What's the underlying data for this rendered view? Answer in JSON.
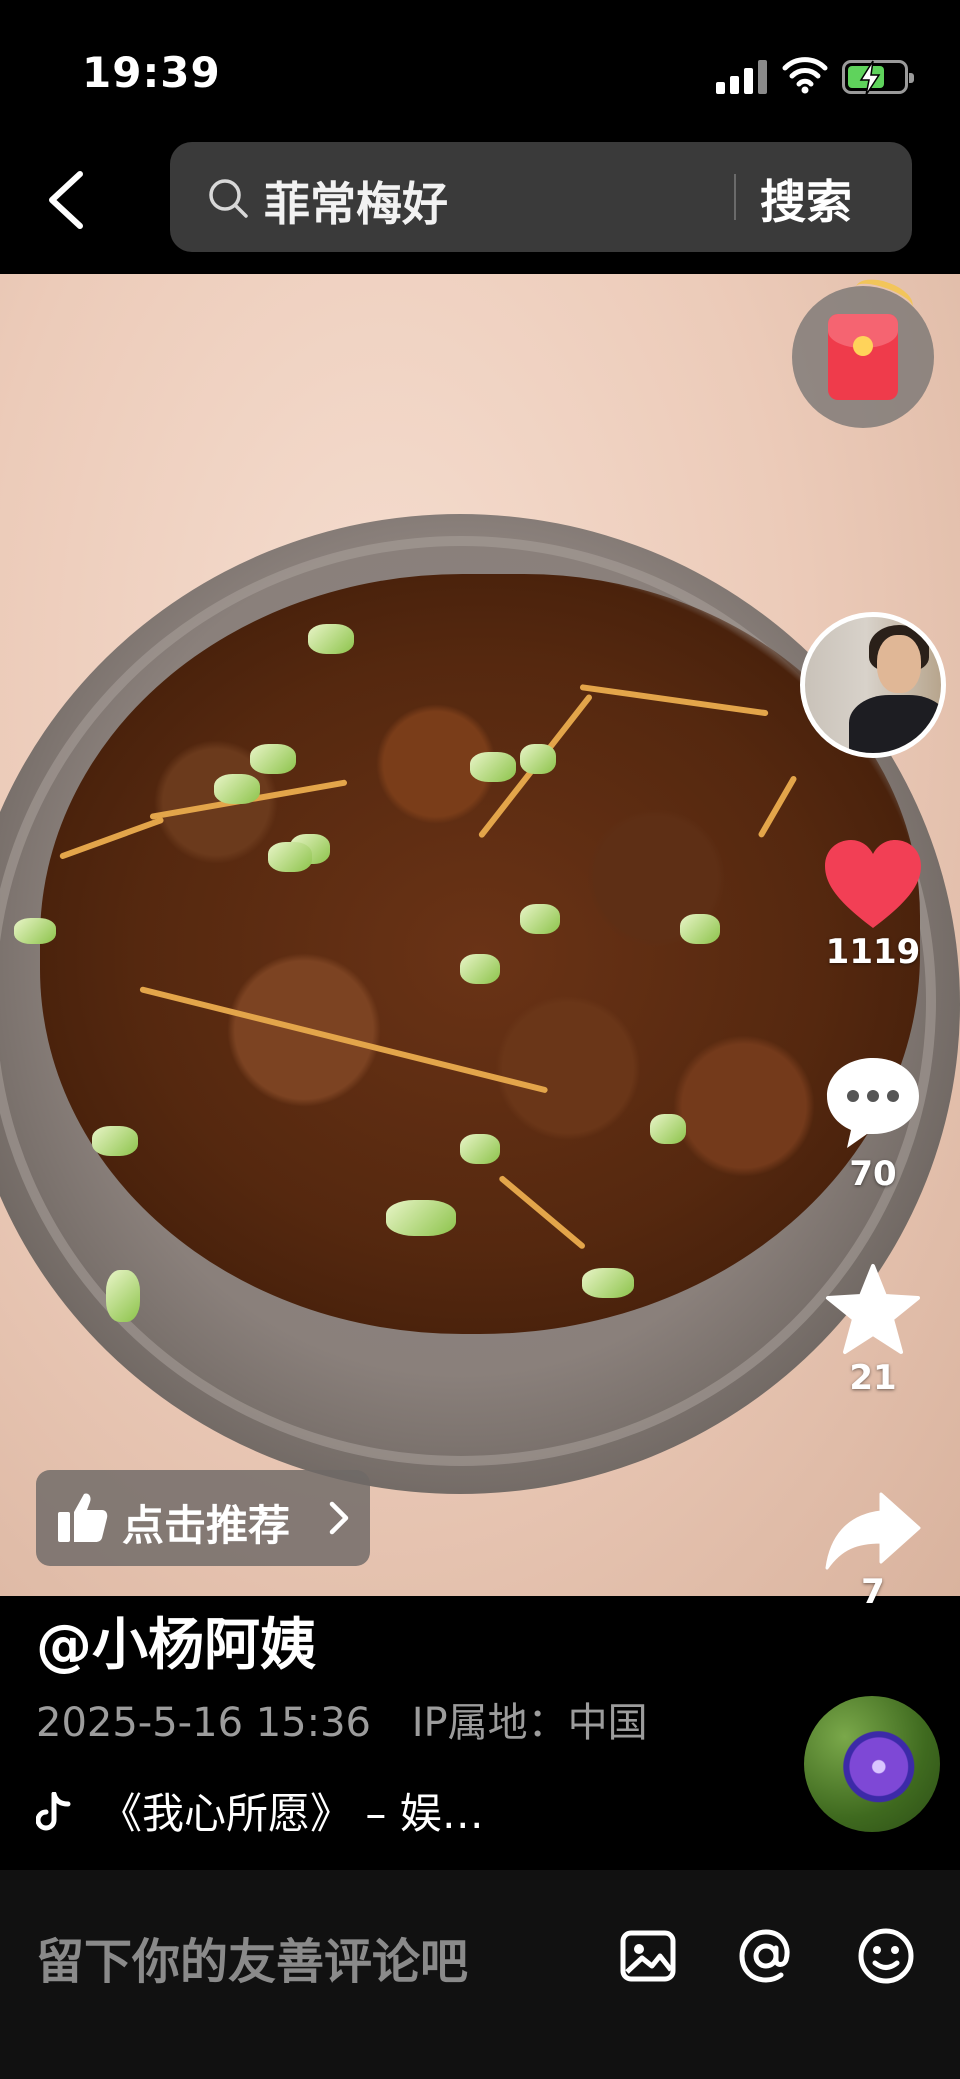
{
  "status_bar": {
    "time": "19:39"
  },
  "header": {
    "search_query": "菲常梅好",
    "search_button": "搜索"
  },
  "actions": {
    "likes": "1119",
    "comments": "70",
    "favorites": "21",
    "shares": "7"
  },
  "recommend": {
    "label": "点击推荐"
  },
  "post": {
    "author": "@小杨阿姨",
    "date": "2025-5-16 15:36",
    "ip_location": "IP属地：中国",
    "music": "《我心所愿》 – 娱…"
  },
  "comment_bar": {
    "placeholder": "留下你的友善评论吧"
  },
  "colors": {
    "like_red": "#f23f55",
    "packet_red": "#ef3b4b",
    "background": "#000000"
  },
  "icons": [
    "back-icon",
    "search-icon",
    "red-packet-icon",
    "heart-icon",
    "comment-icon",
    "star-icon",
    "share-icon",
    "thumbs-up-icon",
    "chevron-right-icon",
    "tiktok-note-icon",
    "image-icon",
    "at-icon",
    "emoji-icon"
  ]
}
